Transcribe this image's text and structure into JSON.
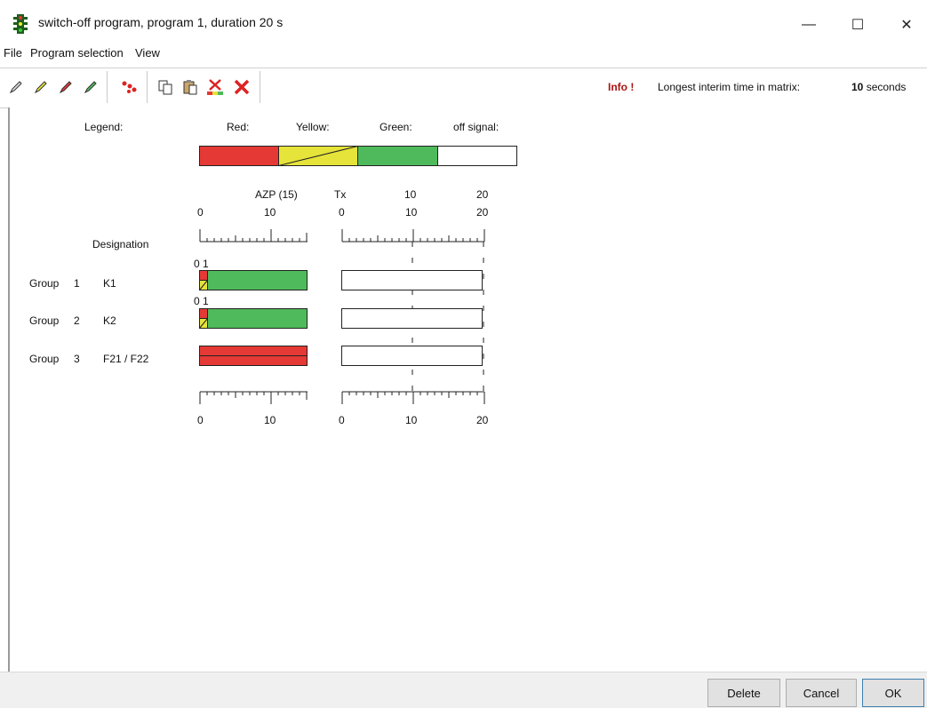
{
  "window": {
    "title": "switch-off program, program 1, duration 20 s",
    "minimize_glyph": "—",
    "maximize_glyph": "☐",
    "close_glyph": "✕"
  },
  "menu": {
    "items": [
      {
        "label": "File"
      },
      {
        "label": "Program selection"
      },
      {
        "label": "View"
      }
    ]
  },
  "toolbar": {
    "icons": [
      "pencil-gray-icon",
      "pencil-yellow-icon",
      "pencil-red-icon",
      "pencil-green-icon",
      "red-dots-icon",
      "copy-icon",
      "paste-icon",
      "delete-colored-icon",
      "red-x-icon"
    ],
    "info_label": "Info !",
    "info_text": "Longest interim time in matrix:",
    "info_value": "10",
    "info_unit": "seconds"
  },
  "legend": {
    "title": "Legend:",
    "red": "Red:",
    "yellow": "Yellow:",
    "green": "Green:",
    "off": "off signal:"
  },
  "colors": {
    "red": "#e53935",
    "yellow": "#e6e33a",
    "green": "#4fba5b",
    "off": "#ffffff"
  },
  "axes": {
    "azp_label": "AZP (15)",
    "tx_label": "Tx",
    "azp_top_ticks": [
      "0",
      "10"
    ],
    "tx_top_ticks": [
      "0",
      "10",
      "20"
    ],
    "tx_top_extra": [
      "10",
      "20"
    ],
    "azp_bottom_ticks": [
      "0",
      "10"
    ],
    "tx_bottom_ticks": [
      "0",
      "10",
      "20"
    ]
  },
  "designation_header": "Designation",
  "groups": [
    {
      "group": "Group",
      "num": "1",
      "designation": "K1",
      "markers": "0 1"
    },
    {
      "group": "Group",
      "num": "2",
      "designation": "K2",
      "markers": "0 1"
    },
    {
      "group": "Group",
      "num": "3",
      "designation": "F21 / F22",
      "markers": ""
    }
  ],
  "buttons": {
    "delete": "Delete",
    "cancel": "Cancel",
    "ok": "OK"
  }
}
